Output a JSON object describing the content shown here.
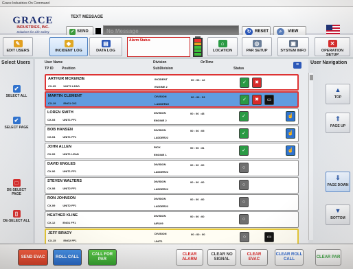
{
  "window": {
    "title": "Grace Industries On Command"
  },
  "logo": {
    "line1": "GRACE",
    "line2": "INDUSTRIES, INC.",
    "line3": "Solutions for Life Safety"
  },
  "message": {
    "label": "TEXT MESSAGE",
    "send": "SEND",
    "placeholder": "No Message"
  },
  "header": {
    "reset": "RESET",
    "view_all": "VIEW ALL"
  },
  "toolbar": {
    "edit_users": "EDIT USERS",
    "incident_log": "INCIDENT LOG",
    "data_log": "DATA LOG",
    "alarm_status": "Alarm Status",
    "location": "LOCATION",
    "par_setup": "PAR SETUP",
    "system_info": "SYSTEM INFO",
    "operation_setup": "OPERATION SETUP"
  },
  "left": {
    "title": "Select Users",
    "select_all": "SELECT ALL",
    "select_page": "SELECT PAGE",
    "deselect_page": "DE-SELECT PAGE",
    "deselect_all": "DE-SELECT ALL"
  },
  "right": {
    "title": "User Navigation",
    "top": "TOP",
    "page_up": "PAGE UP",
    "page_down": "PAGE DOWN",
    "bottom": "BOTTOM"
  },
  "columns": {
    "user_name": "User Name",
    "tp_id": "TP ID",
    "position": "Position",
    "division": "Division",
    "subdivision": "SubDivision",
    "on_time": "OnTime",
    "status": "Status"
  },
  "rows": [
    {
      "name": "ARTHUR MCKENZIE",
      "tp": "CX-05",
      "pos": "UNIT2 LEAD",
      "div": "INCIDENT",
      "sub": "ENGINE 2",
      "time": "00 : 06 : 42",
      "status": [
        "green",
        "red"
      ]
    },
    {
      "name": "MARTIN CLEMENT",
      "tp": "CX-19",
      "pos": "ENG1 OIC",
      "div": "DIVISION",
      "sub": "LADDER22",
      "time": "00 : 06 : 53",
      "status": [
        "green",
        "red",
        "black"
      ]
    },
    {
      "name": "LOREN SMITH",
      "tp": "CX-03",
      "pos": "UNIT1 FF1",
      "div": "DIVISION",
      "sub": "ENGINE 2",
      "time": "00 : 06 : 48",
      "status": [
        "green",
        "blue"
      ]
    },
    {
      "name": "BOB HANSEN",
      "tp": "CX-04",
      "pos": "UNIT1 FF1",
      "div": "DIVISION",
      "sub": "LADDER22",
      "time": "00 : 06 : 05",
      "status": [
        "green",
        "blue"
      ]
    },
    {
      "name": "JOHN ALLEN",
      "tp": "CX-09",
      "pos": "UNIT1 LEAD",
      "div": "RICK",
      "sub": "ENGINE 1",
      "time": "00 : 06 : 31",
      "status": [
        "green",
        "blue"
      ]
    },
    {
      "name": "DAVID ENGLES",
      "tp": "CX-06",
      "pos": "UNIT1 FF1",
      "div": "DIVISION",
      "sub": "LADDER22",
      "time": "00 : 00 : 00",
      "status": [
        "gray"
      ]
    },
    {
      "name": "STEVEN WALTERS",
      "tp": "CX-08",
      "pos": "UNIT2 FF1",
      "div": "DIVISION",
      "sub": "LADDER22",
      "time": "00 : 00 : 00",
      "status": [
        "gray"
      ]
    },
    {
      "name": "RON JOHNSON",
      "tp": "CX-09",
      "pos": "UNIT2 FF1",
      "div": "DIVISION",
      "sub": "LADDER22",
      "time": "00 : 00 : 00",
      "status": [
        "gray"
      ]
    },
    {
      "name": "HEATHER KLINE",
      "tp": "CX-12",
      "pos": "ENG1 FF1",
      "div": "DIVISION",
      "sub": "AIR109",
      "time": "00 : 00 : 00",
      "status": [
        "gray"
      ]
    },
    {
      "name": "JEFF BRADY",
      "tp": "CX-15",
      "pos": "ENG2 FF1",
      "div": "DIVISION",
      "sub": "UNIT1",
      "time": "00 : 00 : 00",
      "status": [
        "gray",
        "black"
      ]
    }
  ],
  "bottom": {
    "send_evac": "SEND EVAC",
    "roll_call": "ROLL CALL",
    "call_for_par": "CALL FOR PAR",
    "clear_alarm": "CLEAR ALARM",
    "clear_no_signal": "CLEAR NO SIGNAL",
    "clear_evac": "CLEAR EVAC",
    "clear_roll_call": "CLEAR ROLL CALL",
    "clear_par": "CLEAR PAR"
  },
  "colors": {
    "accent": "#2f73d0",
    "alarm": "#d72a2a",
    "ok": "#2a9a44"
  }
}
